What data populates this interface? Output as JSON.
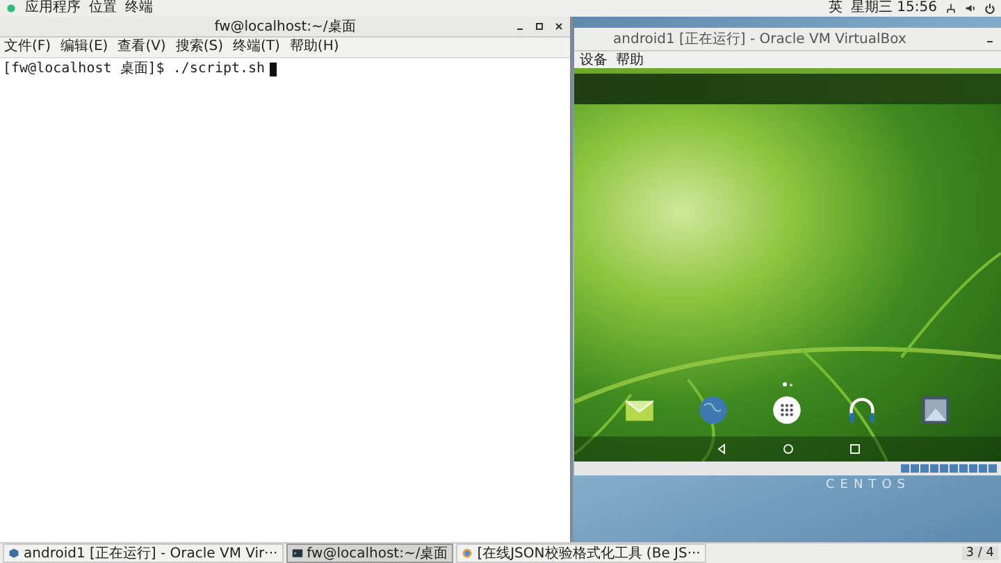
{
  "top_bar": {
    "menus": [
      "应用程序",
      "位置",
      "终端"
    ],
    "input_method": "英",
    "clock": "星期三 15:56"
  },
  "terminal": {
    "title": "fw@localhost:~/桌面",
    "menu": [
      "文件(F)",
      "编辑(E)",
      "查看(V)",
      "搜索(S)",
      "终端(T)",
      "帮助(H)"
    ],
    "prompt": "[fw@localhost 桌面]$ ./script.sh"
  },
  "virtualbox": {
    "title": "android1 [正在运行] - Oracle VM VirtualBox",
    "menu": [
      "设备",
      "帮助"
    ]
  },
  "desktop_label": "CENTOS",
  "taskbar": {
    "items": [
      {
        "label": "android1 [正在运行] - Oracle VM Vir···",
        "selected": false,
        "kind": "vm"
      },
      {
        "label": "fw@localhost:~/桌面",
        "selected": true,
        "kind": "terminal"
      },
      {
        "label": "[在线JSON校验格式化工具 (Be JS···",
        "selected": false,
        "kind": "browser"
      }
    ],
    "workspace": "3 / 4"
  }
}
